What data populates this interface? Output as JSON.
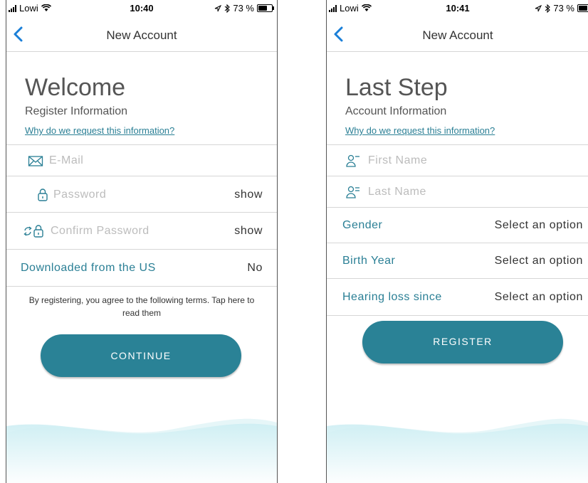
{
  "colors": {
    "accent": "#2a8296",
    "link": "#2a7f95",
    "placeholder": "#bcbcbc",
    "wave": "#d6f0f4"
  },
  "status1": {
    "carrier": "Lowi",
    "time": "10:40",
    "battery": "73 %",
    "battery_level": 0.73
  },
  "status2": {
    "carrier": "Lowi",
    "time": "10:41",
    "battery": "73 %",
    "battery_level": 0.73
  },
  "screen1": {
    "nav_title": "New Account",
    "heading": "Welcome",
    "subheading": "Register Information",
    "why_link": "Why do we request this information?",
    "email_placeholder": "E-Mail",
    "password_placeholder": "Password",
    "password_toggle": "show",
    "confirm_placeholder": "Confirm Password",
    "confirm_toggle": "show",
    "us_label": "Downloaded from the US",
    "us_value": "No",
    "terms": "By registering, you agree to the following terms. Tap here to read them",
    "continue_label": "CONTINUE"
  },
  "screen2": {
    "nav_title": "New Account",
    "heading": "Last Step",
    "subheading": "Account Information",
    "why_link": "Why do we request this information?",
    "first_name_placeholder": "First Name",
    "last_name_placeholder": "Last Name",
    "gender_label": "Gender",
    "gender_value": "Select an option",
    "birth_label": "Birth Year",
    "birth_value": "Select an option",
    "hearing_label": "Hearing loss since",
    "hearing_value": "Select an option",
    "register_label": "REGISTER"
  }
}
